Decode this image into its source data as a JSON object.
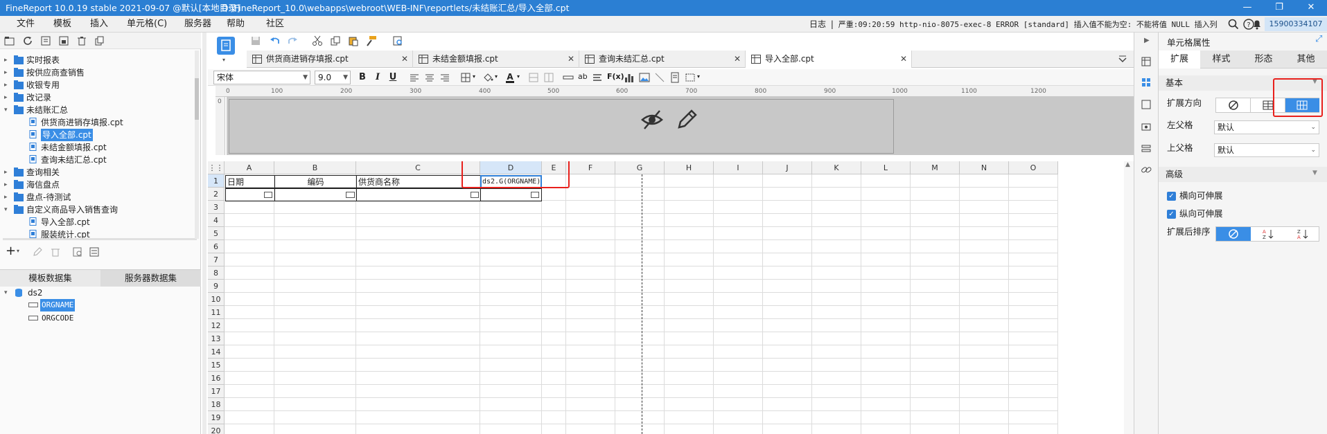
{
  "titlebar": {
    "app": "FineReport 10.0.19 stable 2021-09-07 @默认[本地目录]",
    "path": "D:\\FineReport_10.0\\webapps\\webroot\\WEB-INF\\reportlets/未结账汇总/导入全部.cpt",
    "minimize": "—",
    "restore": "❐",
    "close": "✕"
  },
  "menubar": {
    "items": [
      "文件",
      "模板",
      "插入",
      "单元格(C)",
      "服务器",
      "帮助",
      "社区"
    ],
    "log_label": "日志",
    "log_sep": "|",
    "log_text": "严重:09:20:59 http-nio-8075-exec-8 ERROR [standard] 插入值不能为空: 不能将值 NULL 插入列 '...",
    "user": "15900334107"
  },
  "tree": {
    "items": [
      {
        "label": "实时报表",
        "type": "folder",
        "level": 0,
        "state": "collapsed"
      },
      {
        "label": "按供应商查销售",
        "type": "folder",
        "level": 0,
        "state": "collapsed"
      },
      {
        "label": "收银专用",
        "type": "folder",
        "level": 0,
        "state": "collapsed"
      },
      {
        "label": "改记录",
        "type": "folder",
        "level": 0,
        "state": "collapsed"
      },
      {
        "label": "未结账汇总",
        "type": "folder",
        "level": 0,
        "state": "expanded"
      },
      {
        "label": "供货商进销存填报.cpt",
        "type": "file",
        "level": 1
      },
      {
        "label": "导入全部.cpt",
        "type": "file",
        "level": 1,
        "selected": true
      },
      {
        "label": "未结金额填报.cpt",
        "type": "file",
        "level": 1
      },
      {
        "label": "查询未结汇总.cpt",
        "type": "file",
        "level": 1
      },
      {
        "label": "查询相关",
        "type": "folder",
        "level": 0,
        "state": "collapsed"
      },
      {
        "label": "海信盘点",
        "type": "folder",
        "level": 0,
        "state": "collapsed"
      },
      {
        "label": "盘点-待测试",
        "type": "folder",
        "level": 0,
        "state": "collapsed"
      },
      {
        "label": "自定义商品导入销售查询",
        "type": "folder",
        "level": 0,
        "state": "expanded"
      },
      {
        "label": "导入全部.cpt",
        "type": "file",
        "level": 1
      },
      {
        "label": "服装统计.cpt",
        "type": "file",
        "level": 1
      }
    ]
  },
  "datasets": {
    "tabs": [
      "模板数据集",
      "服务器数据集"
    ],
    "add": "+",
    "dataset_name": "ds2",
    "fields": [
      "ORGNAME",
      "ORGCODE"
    ],
    "selected_field": "ORGNAME"
  },
  "tabs": [
    {
      "label": "供货商进销存填报.cpt",
      "close": "✕"
    },
    {
      "label": "未结金额填报.cpt",
      "close": "✕"
    },
    {
      "label": "查询未结汇总.cpt",
      "close": "✕"
    },
    {
      "label": "导入全部.cpt",
      "close": "✕",
      "active": true
    }
  ],
  "format": {
    "font": "宋体",
    "size": "9.0",
    "bold": "B",
    "italic": "I",
    "underline": "U",
    "ab": "ab",
    "fx": "F(x)"
  },
  "ruler": {
    "ticks": [
      "0",
      "100",
      "200",
      "300",
      "400",
      "500",
      "600",
      "700",
      "800",
      "900",
      "1000",
      "1100",
      "1200"
    ],
    "vtick": "0"
  },
  "grid": {
    "columns": [
      "A",
      "B",
      "C",
      "D",
      "E",
      "F",
      "G",
      "H",
      "I",
      "J",
      "K",
      "L",
      "M",
      "N",
      "O"
    ],
    "rows": [
      "1",
      "2",
      "3",
      "4",
      "5",
      "6",
      "7",
      "8",
      "9",
      "10",
      "11",
      "12",
      "13",
      "14",
      "15",
      "16",
      "17",
      "18",
      "19",
      "20"
    ],
    "corner": "⋮⋮",
    "cells": {
      "A1": "日期",
      "B1": "编码",
      "C1": "供货商名称",
      "D1": "ds2.G(ORGNAME)"
    },
    "selected_cell": "D1"
  },
  "rightpanel": {
    "title": "单元格属性",
    "tabs": [
      "扩展",
      "样式",
      "形态",
      "其他"
    ],
    "active_tab": "扩展",
    "section_basic": "基本",
    "expand_direction_label": "扩展方向",
    "left_parent_label": "左父格",
    "left_parent_value": "默认",
    "up_parent_label": "上父格",
    "up_parent_value": "默认",
    "section_advanced": "高级",
    "horizontal_expand": "横向可伸展",
    "vertical_expand": "纵向可伸展",
    "sort_label": "扩展后排序"
  },
  "colors": {
    "accent": "#3a8ee6",
    "titlebar": "#2b7fd3",
    "highlight_border": "#e8201c"
  }
}
